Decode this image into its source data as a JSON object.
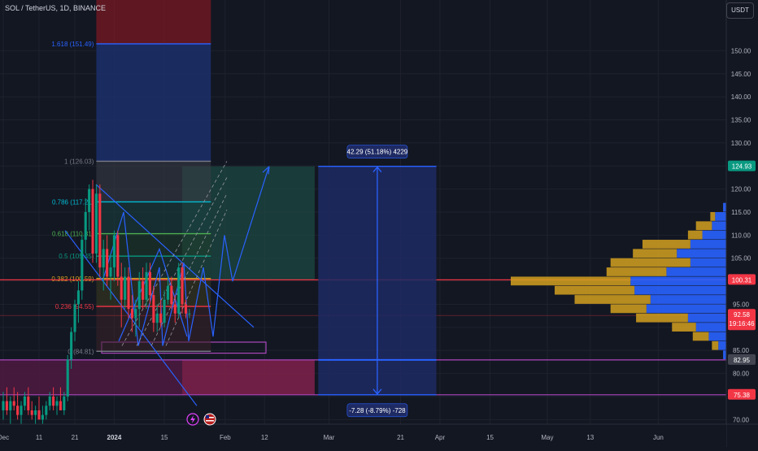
{
  "header": {
    "symbol": "SOL / TetherUS, 1D, BINANCE",
    "unit_label": "USDT"
  },
  "colors": {
    "background": "#131722",
    "grid": "#1e222d",
    "up": "#089981",
    "down": "#f23645",
    "accent_blue": "#2962ff",
    "magenta": "#9c27b0",
    "volume_profile_up": "#d4a01e",
    "volume_profile_down": "#2962ff"
  },
  "chart_data": {
    "type": "candlestick",
    "ylim": [
      69,
      161
    ],
    "price_ticks": [
      "150.00",
      "145.00",
      "140.00",
      "135.00",
      "130.00",
      "125.00",
      "120.00",
      "115.00",
      "110.00",
      "105.00",
      "100.00",
      "95.00",
      "90.00",
      "85.00",
      "80.00",
      "75.00",
      "70.00"
    ],
    "price_tick_values": [
      150,
      145,
      140,
      135,
      130,
      125,
      120,
      115,
      110,
      105,
      100,
      95,
      90,
      85,
      80,
      75,
      70
    ],
    "time_ticks": [
      "Dec",
      "11",
      "21",
      "2024",
      "15",
      "Feb",
      "12",
      "Mar",
      "21",
      "Apr",
      "15",
      "May",
      "13",
      "Jun"
    ],
    "date_range": [
      "2023-12-01",
      "2024-06-10"
    ],
    "time_tick_dates": [
      "2023-12-01",
      "2023-12-11",
      "2023-12-21",
      "2024-01-01",
      "2024-01-15",
      "2024-02-01",
      "2024-02-12",
      "2024-03-01",
      "2024-03-21",
      "2024-04-01",
      "2024-04-15",
      "2024-05-01",
      "2024-05-13",
      "2024-06-01"
    ],
    "candles": [
      {
        "date": "2023-12-01",
        "o": 72,
        "h": 76,
        "l": 70,
        "c": 74
      },
      {
        "date": "2023-12-02",
        "o": 74,
        "h": 77,
        "l": 71,
        "c": 72
      },
      {
        "date": "2023-12-03",
        "o": 72,
        "h": 75,
        "l": 69,
        "c": 74
      },
      {
        "date": "2023-12-04",
        "o": 74,
        "h": 77,
        "l": 72,
        "c": 73
      },
      {
        "date": "2023-12-05",
        "o": 73,
        "h": 76,
        "l": 70,
        "c": 71
      },
      {
        "date": "2023-12-06",
        "o": 71,
        "h": 74,
        "l": 69,
        "c": 73
      },
      {
        "date": "2023-12-07",
        "o": 73,
        "h": 76,
        "l": 72,
        "c": 75
      },
      {
        "date": "2023-12-08",
        "o": 75,
        "h": 77,
        "l": 71,
        "c": 72
      },
      {
        "date": "2023-12-09",
        "o": 72,
        "h": 74,
        "l": 70,
        "c": 71
      },
      {
        "date": "2023-12-10",
        "o": 71,
        "h": 73,
        "l": 69,
        "c": 72
      },
      {
        "date": "2023-12-11",
        "o": 72,
        "h": 75,
        "l": 70,
        "c": 70
      },
      {
        "date": "2023-12-12",
        "o": 70,
        "h": 73,
        "l": 69,
        "c": 71
      },
      {
        "date": "2023-12-13",
        "o": 71,
        "h": 74,
        "l": 70,
        "c": 73
      },
      {
        "date": "2023-12-14",
        "o": 73,
        "h": 76,
        "l": 72,
        "c": 75
      },
      {
        "date": "2023-12-15",
        "o": 75,
        "h": 77,
        "l": 72,
        "c": 73
      },
      {
        "date": "2023-12-16",
        "o": 73,
        "h": 75,
        "l": 71,
        "c": 74
      },
      {
        "date": "2023-12-17",
        "o": 74,
        "h": 77,
        "l": 72,
        "c": 72
      },
      {
        "date": "2023-12-18",
        "o": 72,
        "h": 76,
        "l": 71,
        "c": 75
      },
      {
        "date": "2023-12-19",
        "o": 75,
        "h": 84,
        "l": 74,
        "c": 83
      },
      {
        "date": "2023-12-20",
        "o": 83,
        "h": 90,
        "l": 81,
        "c": 89
      },
      {
        "date": "2023-12-21",
        "o": 89,
        "h": 96,
        "l": 87,
        "c": 95
      },
      {
        "date": "2023-12-22",
        "o": 95,
        "h": 100,
        "l": 91,
        "c": 98
      },
      {
        "date": "2023-12-23",
        "o": 98,
        "h": 110,
        "l": 96,
        "c": 109
      },
      {
        "date": "2023-12-24",
        "o": 109,
        "h": 118,
        "l": 106,
        "c": 115
      },
      {
        "date": "2023-12-25",
        "o": 115,
        "h": 121,
        "l": 111,
        "c": 120
      },
      {
        "date": "2023-12-26",
        "o": 120,
        "h": 122,
        "l": 104,
        "c": 106
      },
      {
        "date": "2023-12-27",
        "o": 106,
        "h": 121,
        "l": 104,
        "c": 119
      },
      {
        "date": "2023-12-28",
        "o": 119,
        "h": 121,
        "l": 101,
        "c": 103
      },
      {
        "date": "2023-12-29",
        "o": 103,
        "h": 109,
        "l": 98,
        "c": 107
      },
      {
        "date": "2023-12-30",
        "o": 107,
        "h": 110,
        "l": 99,
        "c": 101
      },
      {
        "date": "2023-12-31",
        "o": 101,
        "h": 106,
        "l": 96,
        "c": 103
      },
      {
        "date": "2024-01-01",
        "o": 103,
        "h": 111,
        "l": 100,
        "c": 110
      },
      {
        "date": "2024-01-02",
        "o": 110,
        "h": 111,
        "l": 99,
        "c": 101
      },
      {
        "date": "2024-01-03",
        "o": 101,
        "h": 104,
        "l": 90,
        "c": 96
      },
      {
        "date": "2024-01-04",
        "o": 96,
        "h": 103,
        "l": 94,
        "c": 101
      },
      {
        "date": "2024-01-05",
        "o": 101,
        "h": 103,
        "l": 92,
        "c": 94
      },
      {
        "date": "2024-01-06",
        "o": 94,
        "h": 97,
        "l": 89,
        "c": 92
      },
      {
        "date": "2024-01-07",
        "o": 92,
        "h": 96,
        "l": 88,
        "c": 94
      },
      {
        "date": "2024-01-08",
        "o": 94,
        "h": 102,
        "l": 90,
        "c": 100
      },
      {
        "date": "2024-01-09",
        "o": 100,
        "h": 103,
        "l": 94,
        "c": 96
      },
      {
        "date": "2024-01-10",
        "o": 96,
        "h": 104,
        "l": 94,
        "c": 102
      },
      {
        "date": "2024-01-11",
        "o": 102,
        "h": 104,
        "l": 95,
        "c": 97
      },
      {
        "date": "2024-01-12",
        "o": 97,
        "h": 99,
        "l": 89,
        "c": 91
      },
      {
        "date": "2024-01-13",
        "o": 91,
        "h": 95,
        "l": 89,
        "c": 93
      },
      {
        "date": "2024-01-14",
        "o": 93,
        "h": 96,
        "l": 90,
        "c": 91
      },
      {
        "date": "2024-01-15",
        "o": 91,
        "h": 98,
        "l": 90,
        "c": 96
      },
      {
        "date": "2024-01-16",
        "o": 96,
        "h": 101,
        "l": 95,
        "c": 99
      },
      {
        "date": "2024-01-17",
        "o": 99,
        "h": 101,
        "l": 94,
        "c": 95
      },
      {
        "date": "2024-01-18",
        "o": 95,
        "h": 97,
        "l": 91,
        "c": 93
      },
      {
        "date": "2024-01-19",
        "o": 93,
        "h": 104,
        "l": 92,
        "c": 103
      },
      {
        "date": "2024-01-20",
        "o": 103,
        "h": 104,
        "l": 93,
        "c": 95
      },
      {
        "date": "2024-01-21",
        "o": 95,
        "h": 96,
        "l": 92,
        "c": 93
      },
      {
        "date": "2024-01-22",
        "o": 93,
        "h": 94,
        "l": 92,
        "c": 93
      }
    ],
    "last_price": "92.58",
    "countdown": "19:16:46",
    "price_labels": [
      {
        "value": 124.93,
        "text": "124.93",
        "color": "#089981"
      },
      {
        "value": 100.31,
        "text": "100.31",
        "color": "#f23645"
      },
      {
        "value": 82.95,
        "text": "82.95",
        "color": "#434651"
      },
      {
        "value": 75.38,
        "text": "75.38",
        "color": "#f23645"
      }
    ],
    "fibonacci": {
      "start_date": "2023-12-27",
      "end_date": "2024-01-28",
      "levels": [
        {
          "ratio": "1.618",
          "price": 151.49,
          "label": "1.618 (151.49)",
          "color": "#2962ff"
        },
        {
          "ratio": "1",
          "price": 126.03,
          "label": "1 (126.03)",
          "color": "#787b86"
        },
        {
          "ratio": "0.786",
          "price": 117.21,
          "label": "0.786 (117.21)",
          "color": "#00bcd4"
        },
        {
          "ratio": "0.618",
          "price": 110.31,
          "label": "0.618 (110.31)",
          "color": "#4caf50"
        },
        {
          "ratio": "0.5",
          "price": 105.45,
          "label": "0.5 (105.45)",
          "color": "#089981"
        },
        {
          "ratio": "0.382",
          "price": 100.59,
          "label": "0.382 (100.59)",
          "color": "#d4a01e"
        },
        {
          "ratio": "0.236",
          "price": 94.55,
          "label": "0.236 (94.55)",
          "color": "#f23645"
        },
        {
          "ratio": "0",
          "price": 84.81,
          "label": "0 (84.81)",
          "color": "#787b86"
        }
      ]
    },
    "measure": {
      "upper_label": "42.29 (51.18%) 4229",
      "lower_label": "-7.28 (-8.79%) -728",
      "from_price": 100.31,
      "up_price": 124.93,
      "down_price": 75.38,
      "start_date": "2024-02-27",
      "end_date": "2024-03-31"
    },
    "volume_profile": {
      "rows": [
        {
          "price": 116,
          "up": 0,
          "down": 4
        },
        {
          "price": 114,
          "up": 6,
          "down": 14
        },
        {
          "price": 112,
          "up": 20,
          "down": 18
        },
        {
          "price": 110,
          "up": 18,
          "down": 30
        },
        {
          "price": 108,
          "up": 60,
          "down": 45
        },
        {
          "price": 106,
          "up": 55,
          "down": 62
        },
        {
          "price": 104,
          "up": 100,
          "down": 45
        },
        {
          "price": 102,
          "up": 75,
          "down": 75
        },
        {
          "price": 100,
          "up": 150,
          "down": 120
        },
        {
          "price": 98,
          "up": 100,
          "down": 115
        },
        {
          "price": 96,
          "up": 95,
          "down": 95
        },
        {
          "price": 94,
          "up": 45,
          "down": 100
        },
        {
          "price": 92,
          "up": 65,
          "down": 48
        },
        {
          "price": 90,
          "up": 30,
          "down": 38
        },
        {
          "price": 88,
          "up": 20,
          "down": 22
        },
        {
          "price": 86,
          "up": 8,
          "down": 10
        },
        {
          "price": 84,
          "up": 0,
          "down": 4
        }
      ],
      "max": 270
    }
  }
}
